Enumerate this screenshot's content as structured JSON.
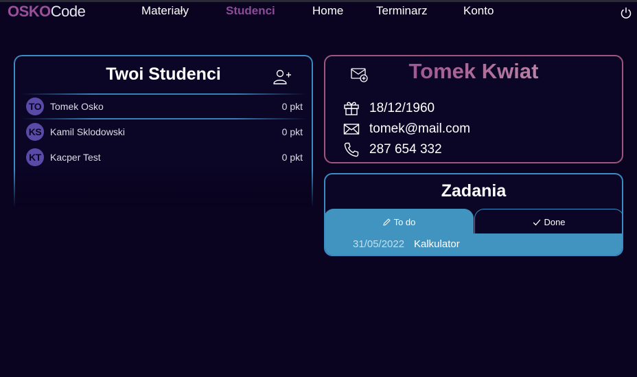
{
  "brand": {
    "part1": "OSKO",
    "part2": "Code"
  },
  "nav": {
    "materials": "Materiały",
    "students": "Studenci",
    "home": "Home",
    "schedule": "Terminarz",
    "account": "Konto"
  },
  "students_panel": {
    "title": "Twoi Studenci",
    "students": [
      {
        "initials": "TO",
        "name": "Tomek Osko",
        "points": "0 pkt"
      },
      {
        "initials": "KS",
        "name": "Kamil Sklodowski",
        "points": "0 pkt"
      },
      {
        "initials": "KT",
        "name": "Kacper Test",
        "points": "0 pkt"
      }
    ]
  },
  "profile": {
    "name": "Tomek Kwiat",
    "birthdate": "18/12/1960",
    "email": "tomek@mail.com",
    "phone": "287 654 332"
  },
  "tasks": {
    "title": "Zadania",
    "tab_todo": "To do",
    "tab_done": "Done",
    "items": [
      {
        "date": "31/05/2022",
        "name": "Kalkulator"
      }
    ]
  },
  "colors": {
    "background": "#0a0420",
    "accent_blue": "#3a8cc6",
    "accent_purple": "#9a4f9a",
    "tab_fill": "#4194c0",
    "avatar": "#5a4aa8"
  },
  "icons": [
    "power-icon",
    "add-user-icon",
    "mail-plus-icon",
    "gift-icon",
    "envelope-icon",
    "phone-icon",
    "pencil-icon",
    "check-icon"
  ]
}
